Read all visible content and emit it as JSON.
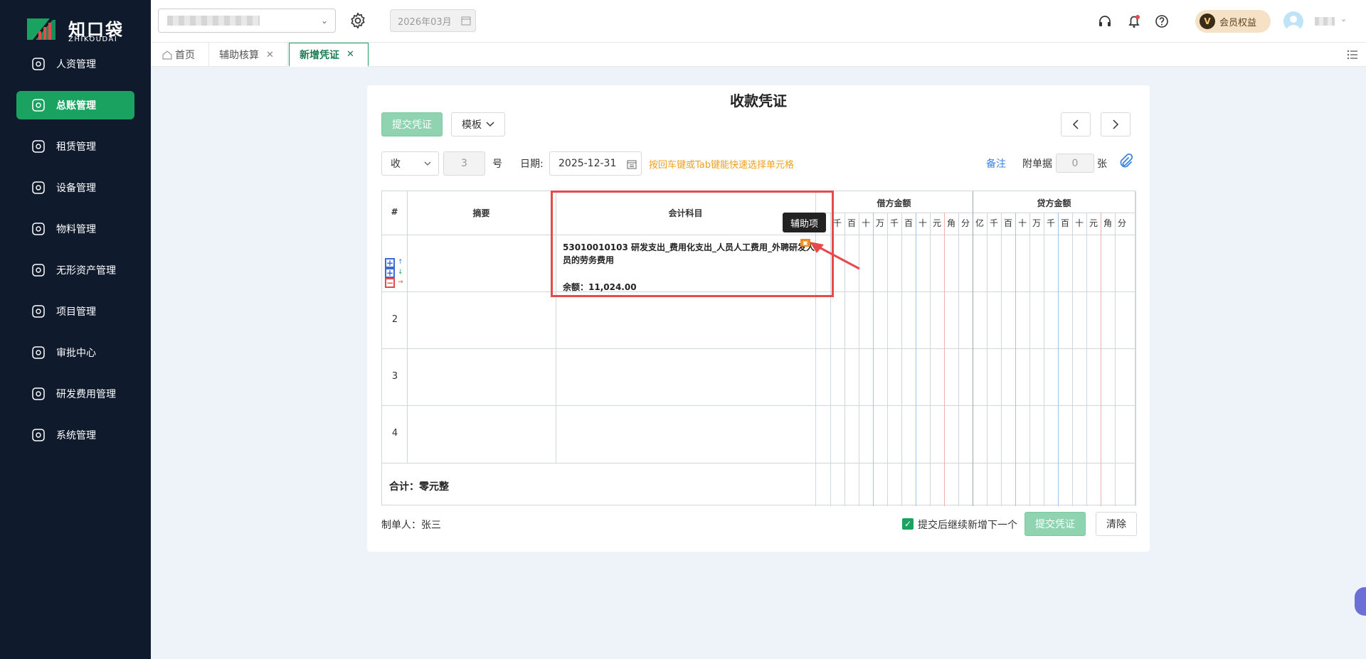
{
  "brand": {
    "name_cn": "知口袋",
    "name_en": "ZHIKOUDAI"
  },
  "sidebar": {
    "items": [
      {
        "label": "人资管理",
        "icon": "user-circle-icon",
        "active": false
      },
      {
        "label": "总账管理",
        "icon": "ledger-icon",
        "active": true
      },
      {
        "label": "租赁管理",
        "icon": "lease-icon",
        "active": false
      },
      {
        "label": "设备管理",
        "icon": "device-icon",
        "active": false
      },
      {
        "label": "物料管理",
        "icon": "material-icon",
        "active": false
      },
      {
        "label": "无形资产管理",
        "icon": "intangible-asset-icon",
        "active": false
      },
      {
        "label": "项目管理",
        "icon": "project-icon",
        "active": false
      },
      {
        "label": "审批中心",
        "icon": "approval-icon",
        "active": false
      },
      {
        "label": "研发费用管理",
        "icon": "rd-expense-icon",
        "active": false
      },
      {
        "label": "系统管理",
        "icon": "gear-icon",
        "active": false
      }
    ]
  },
  "topbar": {
    "period": "2026年03月",
    "vip_label": "会员权益",
    "vip_badge": "V"
  },
  "tabs": [
    {
      "label": "首页",
      "closable": false,
      "active": false
    },
    {
      "label": "辅助核算",
      "closable": true,
      "active": false
    },
    {
      "label": "新增凭证",
      "closable": true,
      "active": true
    }
  ],
  "voucher": {
    "title": "收款凭证",
    "submit_label": "提交凭证",
    "template_label": "模板",
    "type_value": "收",
    "number_value": "3",
    "number_suffix": "号",
    "date_label": "日期:",
    "date_value": "2025-12-31",
    "hint": "按回车键或Tab键能快速选择单元格",
    "note_link": "备注",
    "attach_label": "附单据",
    "attach_value": "0",
    "attach_suffix": "张",
    "columns": {
      "index": "#",
      "summary": "摘要",
      "account": "会计科目",
      "debit": "借方金额",
      "credit": "贷方金额"
    },
    "digits_debit_visible": [
      "千",
      "百",
      "十",
      "万",
      "千",
      "百",
      "十",
      "元",
      "角",
      "分"
    ],
    "digits_credit": [
      "亿",
      "千",
      "百",
      "十",
      "万",
      "千",
      "百",
      "十",
      "元",
      "角",
      "分"
    ],
    "rows": [
      {
        "num": "",
        "account": "53010010103 研发支出_费用化支出_人员人工费用_外聘研发人员的劳务费用",
        "balance": "余额：11,024.00"
      },
      {
        "num": "2",
        "account": "",
        "balance": ""
      },
      {
        "num": "3",
        "account": "",
        "balance": ""
      },
      {
        "num": "4",
        "account": "",
        "balance": ""
      }
    ],
    "total_label": "合计：零元整",
    "tooltip": "辅助项",
    "maker": "制单人：张三",
    "continue_label": "提交后继续新增下一个",
    "footer_submit": "提交凭证",
    "clear_label": "清除"
  }
}
